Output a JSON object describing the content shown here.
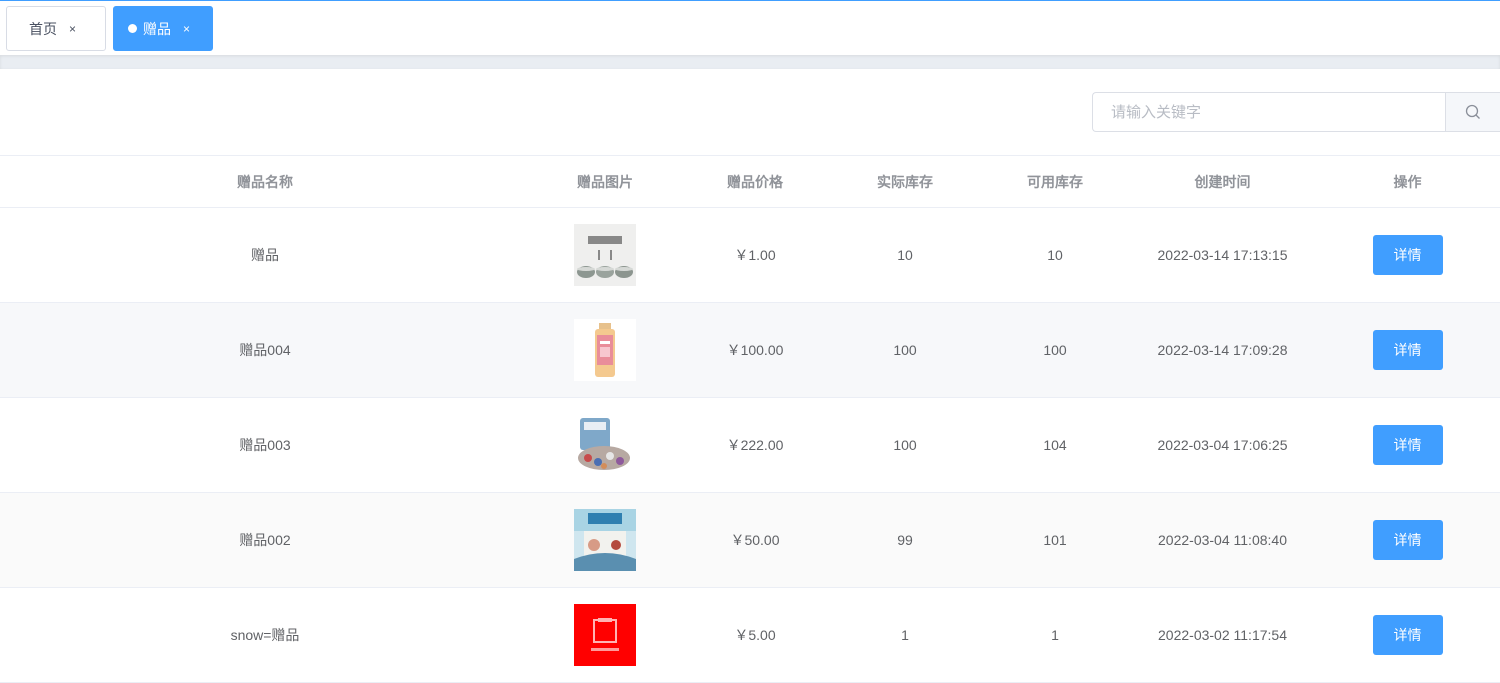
{
  "tabs": [
    {
      "label": "首页",
      "close": "×"
    },
    {
      "label": "赠品",
      "close": "×"
    }
  ],
  "search": {
    "placeholder": "请输入关键字"
  },
  "table": {
    "headers": {
      "name": "赠品名称",
      "image": "赠品图片",
      "price": "赠品价格",
      "actual_stock": "实际库存",
      "available_stock": "可用库存",
      "created": "创建时间",
      "actions": "操作"
    },
    "rows": [
      {
        "name": "赠品",
        "image": "bowls-product-image",
        "price": "￥1.00",
        "actual_stock": "10",
        "available_stock": "10",
        "created": "2022-03-14 17:13:15",
        "action": "详情"
      },
      {
        "name": "赠品004",
        "image": "bottle-drink-image",
        "price": "￥100.00",
        "actual_stock": "100",
        "available_stock": "100",
        "created": "2022-03-14 17:09:28",
        "action": "详情"
      },
      {
        "name": "赠品003",
        "image": "candy-bag-image",
        "price": "￥222.00",
        "actual_stock": "100",
        "available_stock": "104",
        "created": "2022-03-04 17:06:25",
        "action": "详情"
      },
      {
        "name": "赠品002",
        "image": "snack-package-image",
        "price": "￥50.00",
        "actual_stock": "99",
        "available_stock": "101",
        "created": "2022-03-04 11:08:40",
        "action": "详情"
      },
      {
        "name": "snow=赠品",
        "image": "red-box-image",
        "price": "￥5.00",
        "actual_stock": "1",
        "available_stock": "1",
        "created": "2022-03-02 11:17:54",
        "action": "详情"
      }
    ]
  },
  "colors": {
    "primary": "#409eff",
    "header_text": "#909399",
    "body_text": "#606266"
  }
}
